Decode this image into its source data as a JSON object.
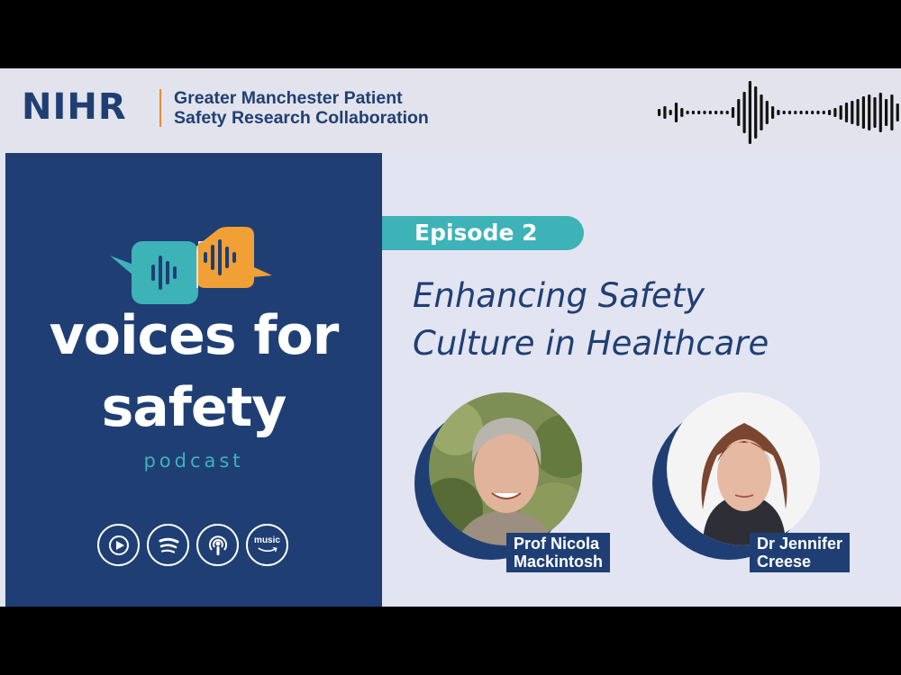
{
  "header": {
    "logo": "NIHR",
    "org_line1": "Greater Manchester Patient",
    "org_line2": "Safety Research Collaboration"
  },
  "show": {
    "title_line1": "voices for",
    "title_line2": "safety",
    "subtitle": "podcast",
    "platforms": [
      {
        "name": "play-icon"
      },
      {
        "name": "spotify-icon"
      },
      {
        "name": "apple-podcasts-icon"
      },
      {
        "name": "amazon-music-icon",
        "label": "music"
      }
    ]
  },
  "episode": {
    "label": "Episode 2",
    "title_line1": "Enhancing Safety",
    "title_line2": "Culture in Healthcare"
  },
  "guests": [
    {
      "name_line1": "Prof Nicola",
      "name_line2": "Mackintosh"
    },
    {
      "name_line1": "Dr Jennifer",
      "name_line2": "Creese"
    }
  ],
  "colors": {
    "navy": "#1f3f74",
    "teal": "#3db3b8",
    "orange": "#f0a034",
    "background": "#e3e4f1"
  }
}
